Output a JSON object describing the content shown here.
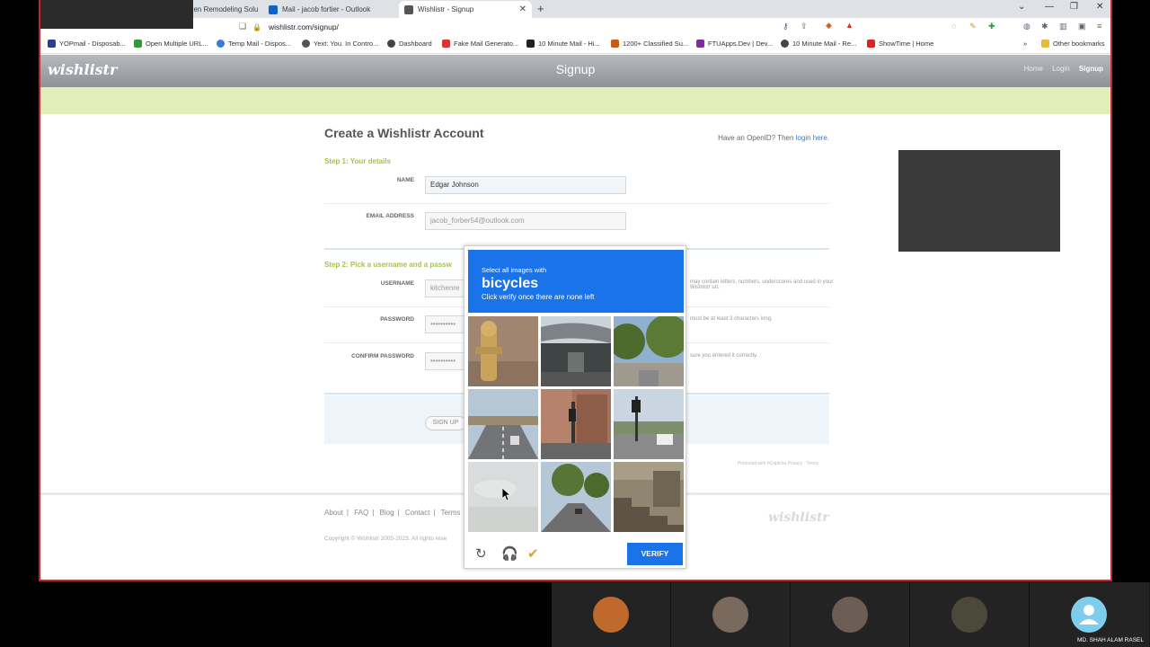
{
  "browser": {
    "tabs": [
      {
        "label": "hen Remodeling Solu"
      },
      {
        "label": "Mail - jacob fortier - Outlook"
      },
      {
        "label": "Wishlistr - Signup"
      }
    ],
    "url": "wishlistr.com/signup/",
    "bookmarks": [
      "YOPmail - Disposab...",
      "Open Multiple URL...",
      "Temp Mail - Dispos...",
      "Yext: You. In Contro...",
      "Dashboard",
      "Fake Mail Generato...",
      "10 Minute Mail - Hi...",
      "1200+ Classified Su...",
      "FTUApps.Dev | Dev...",
      "10 Minute Mail - Re...",
      "ShowTime | Home"
    ],
    "other_bookmarks": "Other bookmarks"
  },
  "site": {
    "logo": "wishlistr",
    "header_title": "Signup",
    "nav": [
      "Home",
      "Login",
      "Signup"
    ],
    "page_title": "Create a Wishlistr Account",
    "openid_text": "Have an OpenID? Then ",
    "openid_link": "login here.",
    "step1": "Step 1: Your details",
    "step2": "Step 2: Pick a username and a passw",
    "labels": {
      "name": "NAME",
      "email": "EMAIL ADDRESS",
      "username": "USERNAME",
      "password": "PASSWORD",
      "confirm": "CONFIRM PASSWORD"
    },
    "values": {
      "name": "Edgar Johnson",
      "email": "jacob_forber54@outlook.com",
      "username": "kitchenre",
      "password": "••••••••••",
      "confirm": "••••••••••"
    },
    "hints": {
      "username": "may contain letters, numbers, underscores and used in your Wishlistr url.",
      "password": "must be at least 3 characters long.",
      "confirm": "sure you entered it correctly."
    },
    "signup_button": "SIGN UP",
    "powered": "Protected with hCaptcha  Privacy · Terms",
    "footer_links": [
      "About",
      "FAQ",
      "Blog",
      "Contact",
      "Terms"
    ],
    "copyright": "Copyright © Wishlistr 2005-2023. All rights rese",
    "footer_logo": "wishlistr"
  },
  "captcha": {
    "line1": "Select all images with",
    "keyword": "bicycles",
    "line3": "Click verify once there are none left",
    "verify_label": "VERIFY",
    "tiles": [
      "hydrant",
      "overpass",
      "street-trees",
      "highway",
      "intersection",
      "traffic-light",
      "blank",
      "road-trees",
      "stairs"
    ]
  },
  "meeting": {
    "participant_name": "MD. SHAH ALAM RASEL"
  },
  "colors": {
    "accent": "#1a73e8",
    "header": "#9a9ea2",
    "green_band": "#e1eeb8",
    "step": "#a5c14f"
  }
}
